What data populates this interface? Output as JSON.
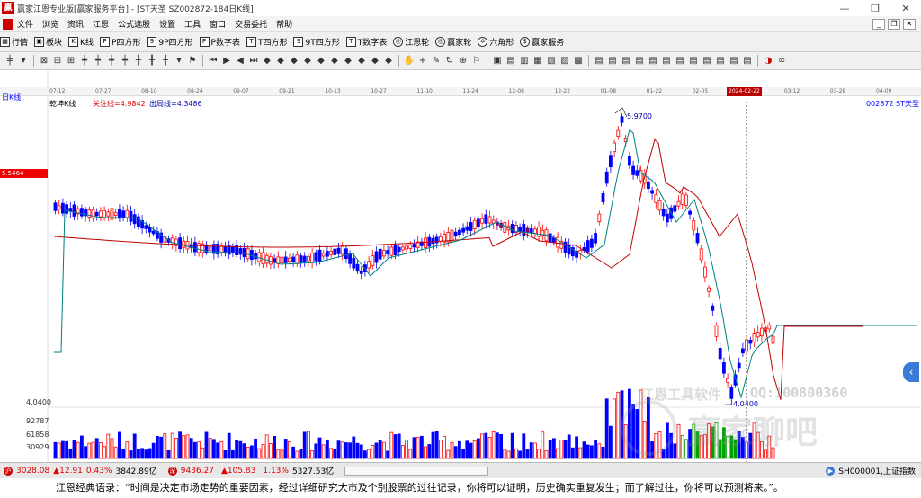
{
  "titlebar": {
    "text": "赢家江恩专业版[赢家服务平台] - [ST天圣  SZ002872-184日K线]"
  },
  "menu": [
    "文件",
    "浏览",
    "资讯",
    "江恩",
    "公式选股",
    "设置",
    "工具",
    "窗口",
    "交易委托",
    "帮助"
  ],
  "toolbar1": [
    {
      "icon": "grid-icon",
      "label": "行情"
    },
    {
      "icon": "block-icon",
      "label": "板块"
    },
    {
      "icon": "kline-icon",
      "label": "K线"
    },
    {
      "icon": "p-square-icon",
      "label": "P四方形"
    },
    {
      "icon": "9p-square-icon",
      "label": "9P四方形"
    },
    {
      "icon": "pn-table-icon",
      "label": "P数字表"
    },
    {
      "icon": "t-square-icon",
      "label": "T四方形"
    },
    {
      "icon": "9t-square-icon",
      "label": "9T四方形"
    },
    {
      "icon": "tn-table-icon",
      "label": "T数字表"
    },
    {
      "icon": "wheel-icon",
      "label": "江恩轮"
    },
    {
      "icon": "wheel-icon",
      "label": "赢家轮"
    },
    {
      "icon": "hexagram-icon",
      "label": "六角形"
    },
    {
      "icon": "dollar-icon",
      "label": "赢家服务"
    }
  ],
  "chart_header": {
    "period_label": "日K线",
    "pane_title": "乾坤K线",
    "follow_line": "关注线=4.9842",
    "exit_line": "出局线=4.3486",
    "code_name": "002872  ST天圣",
    "price_tag": "5.5464",
    "high_label": "5.9700",
    "low_label": "4.0400",
    "price_axis_low": "4.0400"
  },
  "date_axis": [
    "07-12",
    "07-27",
    "08-10",
    "08-24",
    "09-07",
    "09-21",
    "10-13",
    "10-27",
    "11-10",
    "11-24",
    "12-08",
    "12-22",
    "01-08",
    "01-22",
    "02-05",
    "2024-02-22",
    "03-12",
    "03-28",
    "04-09"
  ],
  "volume_axis": [
    "92787",
    "61858",
    "30929"
  ],
  "watermark": {
    "line1": "江恩工具软件",
    "line2": "QQ:100800360",
    "line3": "赢家聊吧"
  },
  "statusbar": {
    "sh_value": "3028.08",
    "sh_change": "▲12.91",
    "sh_pct": "0.43%",
    "sh_amount": "3842.89亿",
    "sz_badge": "深",
    "sz_value": "9436.27",
    "sz_change": "▲105.83",
    "sz_pct": "1.13%",
    "sz_amount": "5327.53亿",
    "index_label": "SH000001,上证指数"
  },
  "quote": "江恩经典语录：“时间是决定市场走势的重要因素，经过详细研究大市及个别股票的过往记录，你将可以证明，历史确实重复发生；而了解过往，你将可以预测将来。”。",
  "colors": {
    "up": "#ff0000",
    "down": "#0000ff",
    "ma_red": "#c00000",
    "ma_green": "#008080",
    "mixed": "#800080"
  },
  "chart_data": {
    "type": "candlestick",
    "high": 5.97,
    "low": 4.04,
    "follow_line": 4.9842,
    "exit_line": 4.3486,
    "cursor_date": "2024-02-22"
  }
}
